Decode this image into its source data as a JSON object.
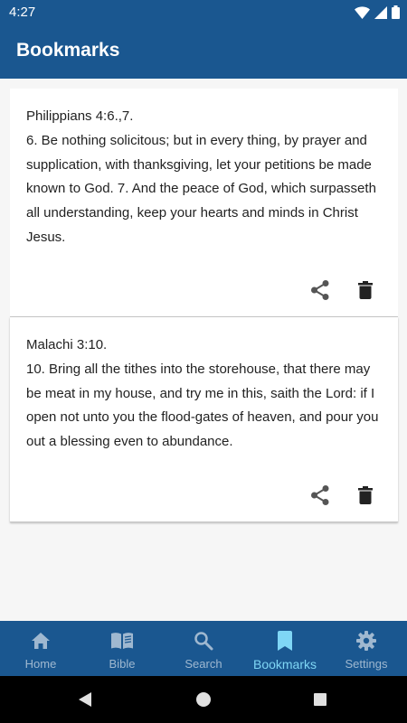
{
  "status_bar": {
    "time": "4:27"
  },
  "app_bar": {
    "title": "Bookmarks"
  },
  "bookmarks": [
    {
      "reference": "Philippians 4:6.,7.",
      "text": "6. Be nothing solicitous; but in every thing, by prayer and supplication, with thanksgiving, let your petitions be made known to God. 7. And the peace of God, which surpasseth all understanding, keep your hearts and minds in Christ Jesus."
    },
    {
      "reference": "Malachi 3:10.",
      "text": "10. Bring all the tithes into the storehouse, that there may be meat in my house, and try me in this, saith the Lord: if I open not unto you the flood-gates of heaven, and pour you out a blessing even to abundance."
    }
  ],
  "bottom_nav": {
    "items": [
      {
        "label": "Home",
        "icon": "home-icon"
      },
      {
        "label": "Bible",
        "icon": "book-icon"
      },
      {
        "label": "Search",
        "icon": "search-icon"
      },
      {
        "label": "Bookmarks",
        "icon": "bookmark-icon",
        "active": true
      },
      {
        "label": "Settings",
        "icon": "gear-icon"
      }
    ]
  },
  "colors": {
    "primary": "#1a5790",
    "active_nav": "#7fd6f5",
    "inactive_nav": "#9fb8d0",
    "background": "#f6f6f6"
  }
}
